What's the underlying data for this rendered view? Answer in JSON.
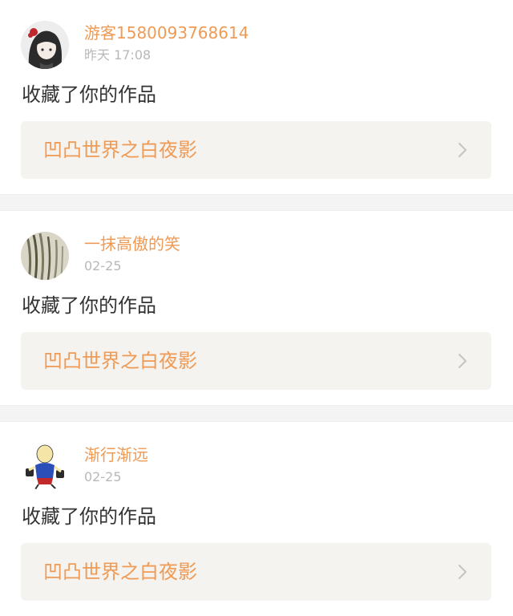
{
  "notifications": [
    {
      "user_name": "游客1580093768614",
      "timestamp": "昨天 17:08",
      "action": "收藏了你的作品",
      "work_title": "凹凸世界之白夜影",
      "avatar_icon": "anime-girl-avatar-icon"
    },
    {
      "user_name": "一抹高傲的笑",
      "timestamp": "02-25",
      "action": "收藏了你的作品",
      "work_title": "凹凸世界之白夜影",
      "avatar_icon": "hair-profile-avatar-icon"
    },
    {
      "user_name": "渐行渐远",
      "timestamp": "02-25",
      "action": "收藏了你的作品",
      "work_title": "凹凸世界之白夜影",
      "avatar_icon": "cartoon-character-avatar-icon"
    }
  ],
  "colors": {
    "accent": "#ef9a55",
    "timestamp": "#b8b8b8",
    "body_text": "#333333",
    "link_bg": "#f4f3ef",
    "separator": "#f4f4f4"
  }
}
